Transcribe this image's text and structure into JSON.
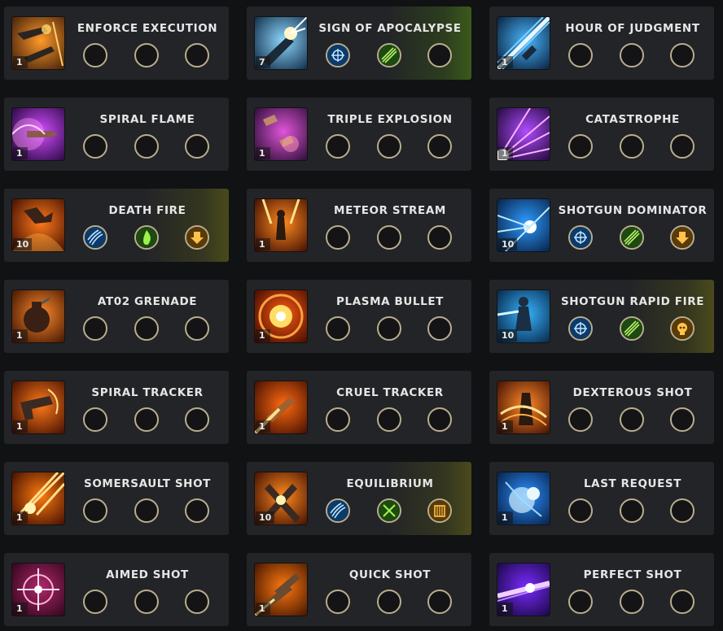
{
  "skills": [
    {
      "name": "ENFORCE EXECUTION",
      "level": "1",
      "art": "guns",
      "glow": "",
      "slots": [
        "",
        "",
        ""
      ]
    },
    {
      "name": "SIGN OF APOCALYPSE",
      "level": "7",
      "art": "blue-gun",
      "glow": "green",
      "slots": [
        "blue-crosshair",
        "green-slash",
        ""
      ]
    },
    {
      "name": "HOUR OF JUDGMENT",
      "level": "1",
      "art": "blue-beam",
      "glow": "",
      "slots": [
        "",
        "",
        ""
      ]
    },
    {
      "name": "SPIRAL FLAME",
      "level": "1",
      "art": "purple-bullet",
      "glow": "",
      "slots": [
        "",
        "",
        ""
      ]
    },
    {
      "name": "TRIPLE EXPLOSION",
      "level": "1",
      "art": "pink-bullets",
      "glow": "",
      "slots": [
        "",
        "",
        ""
      ]
    },
    {
      "name": "CATASTROPHE",
      "level": "1",
      "art": "purple-rays",
      "glow": "",
      "slots": [
        "",
        "",
        ""
      ]
    },
    {
      "name": "DEATH FIRE",
      "level": "10",
      "art": "fire-hands",
      "glow": "olive",
      "slots": [
        "blue-claw",
        "green-flame",
        "orange-down"
      ]
    },
    {
      "name": "METEOR STREAM",
      "level": "1",
      "art": "fire-figure",
      "glow": "",
      "slots": [
        "",
        "",
        ""
      ]
    },
    {
      "name": "SHOTGUN DOMINATOR",
      "level": "10",
      "art": "blue-burst",
      "glow": "",
      "slots": [
        "blue-crosshair",
        "green-slash",
        "orange-down"
      ]
    },
    {
      "name": "AT02 GRENADE",
      "level": "1",
      "art": "grenade",
      "glow": "",
      "slots": [
        "",
        "",
        ""
      ]
    },
    {
      "name": "PLASMA BULLET",
      "level": "1",
      "art": "plasma",
      "glow": "",
      "slots": [
        "",
        "",
        ""
      ]
    },
    {
      "name": "SHOTGUN RAPID FIRE",
      "level": "10",
      "art": "blue-figure",
      "glow": "olive",
      "slots": [
        "blue-crosshair",
        "green-slash",
        "orange-skull"
      ]
    },
    {
      "name": "SPIRAL TRACKER",
      "level": "1",
      "art": "revolver",
      "glow": "",
      "slots": [
        "",
        "",
        ""
      ]
    },
    {
      "name": "CRUEL TRACKER",
      "level": "1",
      "art": "fire-bullet",
      "glow": "",
      "slots": [
        "",
        "",
        ""
      ]
    },
    {
      "name": "DEXTEROUS SHOT",
      "level": "1",
      "art": "fire-spin",
      "glow": "",
      "slots": [
        "",
        "",
        ""
      ]
    },
    {
      "name": "SOMERSAULT SHOT",
      "level": "1",
      "art": "fire-streaks",
      "glow": "",
      "slots": [
        "",
        "",
        ""
      ]
    },
    {
      "name": "EQUILIBRIUM",
      "level": "10",
      "art": "crossed-guns",
      "glow": "olive",
      "slots": [
        "blue-claw",
        "green-cross",
        "orange-gate"
      ]
    },
    {
      "name": "LAST REQUEST",
      "level": "1",
      "art": "blue-blast",
      "glow": "",
      "slots": [
        "",
        "",
        ""
      ]
    },
    {
      "name": "AIMED SHOT",
      "level": "1",
      "art": "pink-star",
      "glow": "",
      "slots": [
        "",
        "",
        ""
      ]
    },
    {
      "name": "QUICK SHOT",
      "level": "1",
      "art": "bullets",
      "glow": "",
      "slots": [
        "",
        "",
        ""
      ]
    },
    {
      "name": "PERFECT SHOT",
      "level": "1",
      "art": "violet-shot",
      "glow": "",
      "slots": [
        "",
        "",
        ""
      ]
    }
  ],
  "colors": {
    "card": "#232427",
    "slot_ring": "#b9ad8e",
    "text": "#e6e6e6"
  }
}
